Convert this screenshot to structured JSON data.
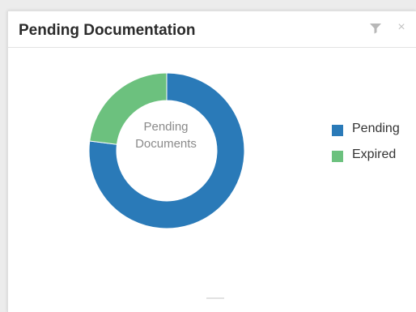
{
  "widget": {
    "title": "Pending Documentation",
    "filter_icon": "filter-icon",
    "close_icon": "close-icon",
    "close_glyph": "×"
  },
  "chart_data": {
    "type": "pie",
    "center_label_line1": "Pending",
    "center_label_line2": "Documents",
    "legend_placement": "right",
    "categories": [
      "Pending",
      "Expired"
    ],
    "values": [
      77,
      23
    ],
    "colors": [
      "#2a7ab8",
      "#6cc17e"
    ]
  }
}
